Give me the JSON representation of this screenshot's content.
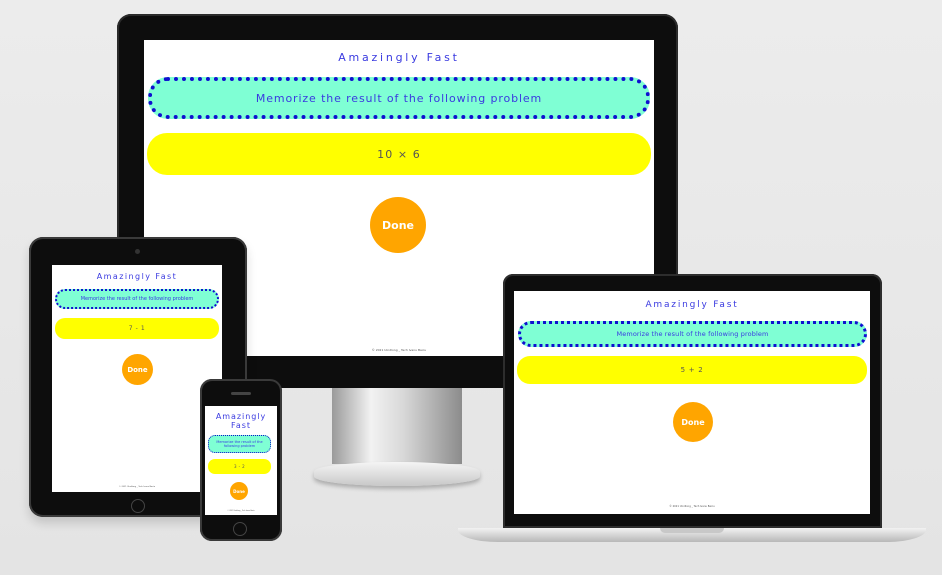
{
  "desktop": {
    "title": "Amazingly Fast",
    "instruction": "Memorize the result of the following problem",
    "problem": "10 × 6",
    "done_label": "Done",
    "footer": "© 2021 Uindlong _ Tech Ivanu Baciu"
  },
  "tablet": {
    "title": "Amazingly Fast",
    "instruction": "Memorize the result of the following problem",
    "problem": "7 - 1",
    "done_label": "Done",
    "footer": "© 2021 Uindlong _ Tech Ivanu Baciu"
  },
  "phone": {
    "title": "Amazingly Fast",
    "instruction": "Memorize the result of the following problem",
    "problem": "3 - 2",
    "done_label": "Done",
    "footer": "© 2021 Uindlong _ Tech Ivanu Baciu"
  },
  "laptop": {
    "title": "Amazingly Fast",
    "instruction": "Memorize the result of the following problem",
    "problem": "5 + 2",
    "done_label": "Done",
    "footer": "© 2021 Uindlong _ Tech Ivanu Baciu"
  },
  "colors": {
    "title": "#3a3ae0",
    "instruction_bg": "#7fffd4",
    "instruction_border": "#1010d0",
    "problem_bg": "#ffff00",
    "done_bg": "#ffa500"
  }
}
